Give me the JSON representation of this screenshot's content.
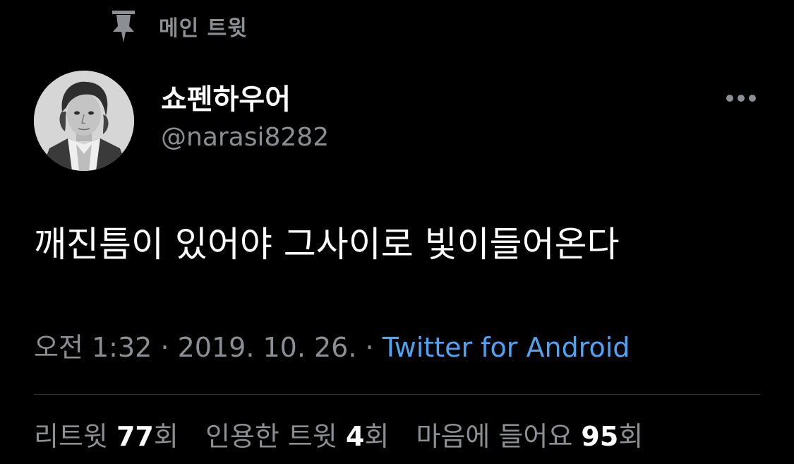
{
  "header": {
    "pinned_label": "메인 트윗",
    "pin_icon": "pin-icon"
  },
  "author": {
    "display_name": "쇼펜하우어",
    "handle": "@narasi8282",
    "avatar_icon": "portrait-avatar"
  },
  "more_icon": "ellipsis-icon",
  "tweet": {
    "text": "깨진틈이 있어야 그사이로 빛이들어온다"
  },
  "meta": {
    "time": "오전 1:32",
    "separator": "·",
    "date": "2019. 10. 26.",
    "source": "Twitter for Android"
  },
  "stats": {
    "retweets_label": "리트윗",
    "retweets_count": "77",
    "retweets_unit": "회",
    "quotes_label": "인용한 트윗",
    "quotes_count": "4",
    "quotes_unit": "회",
    "likes_label": "마음에 들어요",
    "likes_count": "95",
    "likes_unit": "회"
  },
  "colors": {
    "background": "#000000",
    "secondary_text": "#8b8f94",
    "link": "#4fa3f0",
    "divider": "#2f3336"
  }
}
